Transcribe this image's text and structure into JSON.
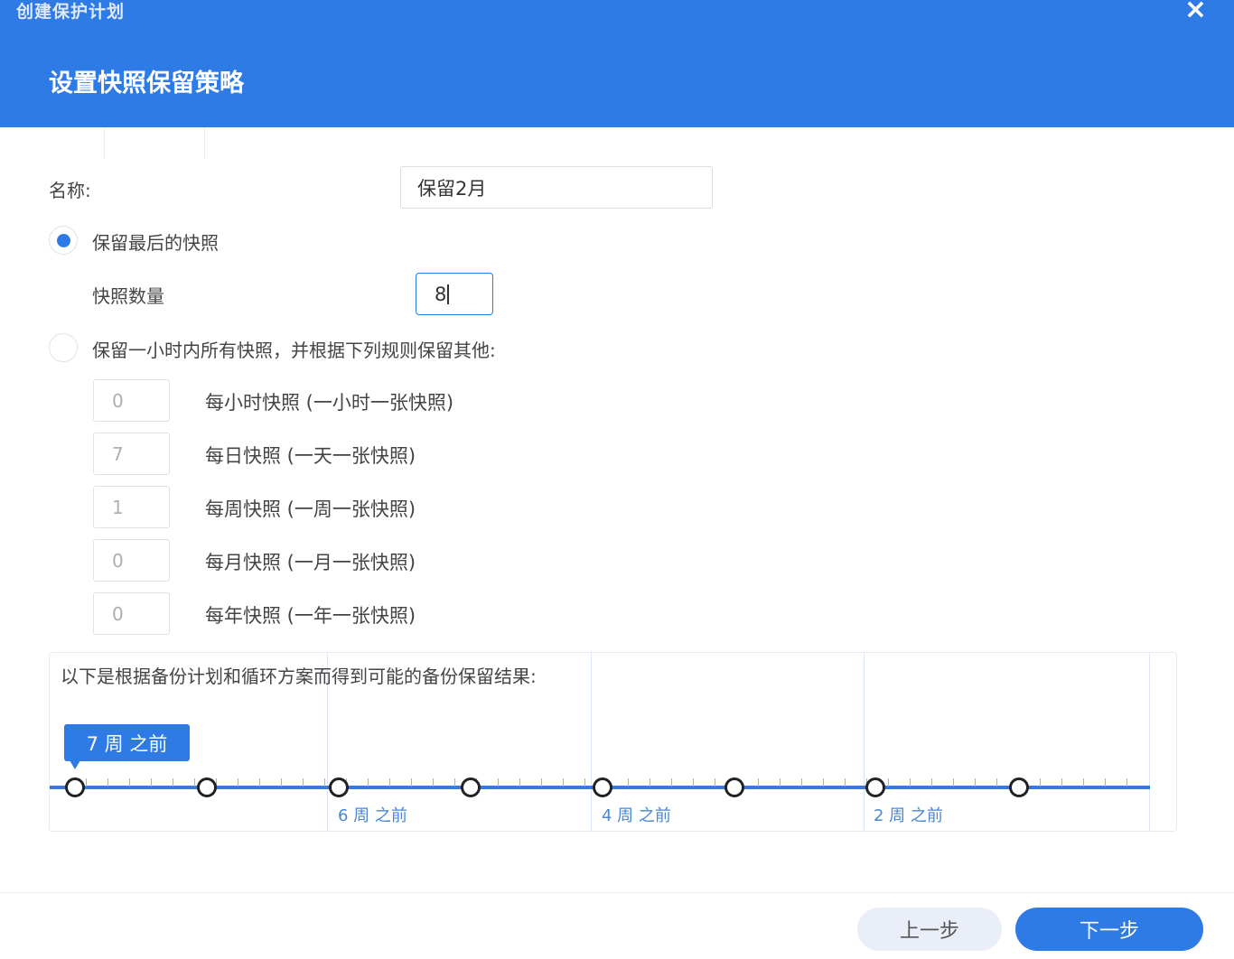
{
  "window": {
    "title": "创建保护计划",
    "close_icon": "×"
  },
  "step_title": "设置快照保留策略",
  "name_field": {
    "label": "名称:",
    "value": "保留2月"
  },
  "option_last": {
    "label": "保留最后的快照",
    "selected": true
  },
  "snapshot_count": {
    "label": "快照数量",
    "value": "8"
  },
  "option_rules": {
    "label": "保留一小时内所有快照，并根据下列规则保留其他:",
    "selected": false
  },
  "rules": [
    {
      "value": "0",
      "label": "每小时快照 (一小时一张快照)"
    },
    {
      "value": "7",
      "label": "每日快照 (一天一张快照)"
    },
    {
      "value": "1",
      "label": "每周快照 (一周一张快照)"
    },
    {
      "value": "0",
      "label": "每月快照 (一月一张快照)"
    },
    {
      "value": "0",
      "label": "每年快照 (一年一张快照)"
    }
  ],
  "result": {
    "title": "以下是根据备份计划和循环方案而得到可能的备份保留结果:",
    "bubble": "7 周 之前",
    "week_labels": [
      "6 周 之前",
      "4 周 之前",
      "2 周 之前"
    ]
  },
  "buttons": {
    "prev": "上一步",
    "next": "下一步"
  },
  "colors": {
    "primary": "#2f7be6",
    "header": "#2f7be6"
  }
}
